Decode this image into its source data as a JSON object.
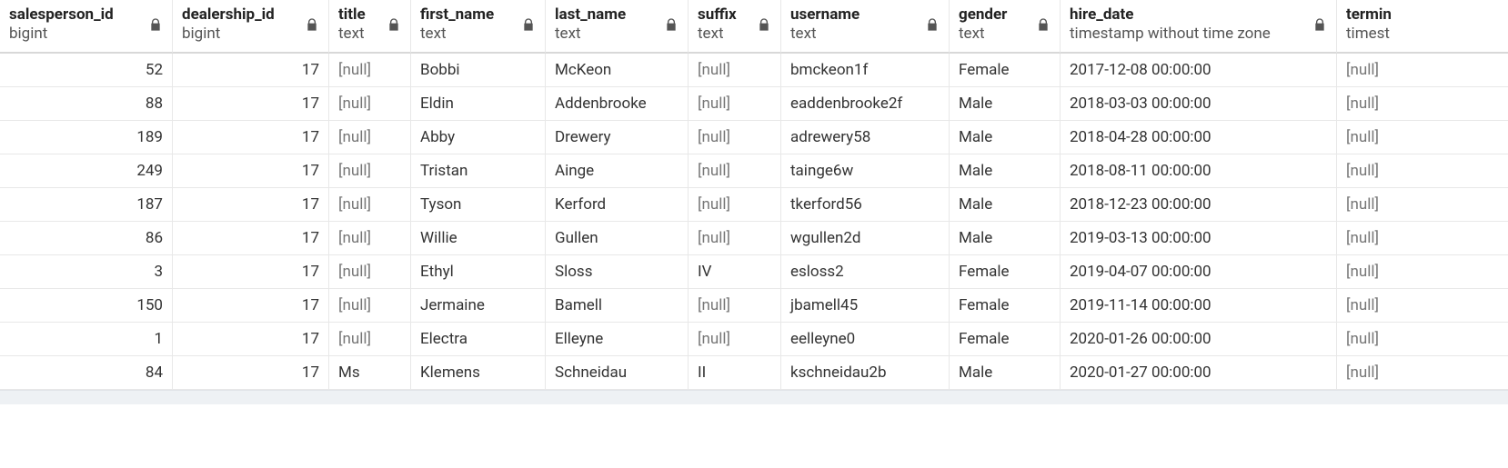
{
  "null_label": "[null]",
  "columns": [
    {
      "name": "salesperson_id",
      "type": "bigint",
      "align": "num",
      "locked": true
    },
    {
      "name": "dealership_id",
      "type": "bigint",
      "align": "num",
      "locked": true
    },
    {
      "name": "title",
      "type": "text",
      "align": "left",
      "locked": true
    },
    {
      "name": "first_name",
      "type": "text",
      "align": "left",
      "locked": true
    },
    {
      "name": "last_name",
      "type": "text",
      "align": "left",
      "locked": true
    },
    {
      "name": "suffix",
      "type": "text",
      "align": "left",
      "locked": true
    },
    {
      "name": "username",
      "type": "text",
      "align": "left",
      "locked": true
    },
    {
      "name": "gender",
      "type": "text",
      "align": "left",
      "locked": true
    },
    {
      "name": "hire_date",
      "type": "timestamp without time zone",
      "align": "left",
      "locked": true
    },
    {
      "name": "termin",
      "type": "timest",
      "align": "left",
      "locked": false
    }
  ],
  "rows": [
    {
      "salesperson_id": 52,
      "dealership_id": 17,
      "title": null,
      "first_name": "Bobbi",
      "last_name": "McKeon",
      "suffix": null,
      "username": "bmckeon1f",
      "gender": "Female",
      "hire_date": "2017-12-08 00:00:00",
      "termin": null
    },
    {
      "salesperson_id": 88,
      "dealership_id": 17,
      "title": null,
      "first_name": "Eldin",
      "last_name": "Addenbrooke",
      "suffix": null,
      "username": "eaddenbrooke2f",
      "gender": "Male",
      "hire_date": "2018-03-03 00:00:00",
      "termin": null
    },
    {
      "salesperson_id": 189,
      "dealership_id": 17,
      "title": null,
      "first_name": "Abby",
      "last_name": "Drewery",
      "suffix": null,
      "username": "adrewery58",
      "gender": "Male",
      "hire_date": "2018-04-28 00:00:00",
      "termin": null
    },
    {
      "salesperson_id": 249,
      "dealership_id": 17,
      "title": null,
      "first_name": "Tristan",
      "last_name": "Ainge",
      "suffix": null,
      "username": "tainge6w",
      "gender": "Male",
      "hire_date": "2018-08-11 00:00:00",
      "termin": null
    },
    {
      "salesperson_id": 187,
      "dealership_id": 17,
      "title": null,
      "first_name": "Tyson",
      "last_name": "Kerford",
      "suffix": null,
      "username": "tkerford56",
      "gender": "Male",
      "hire_date": "2018-12-23 00:00:00",
      "termin": null
    },
    {
      "salesperson_id": 86,
      "dealership_id": 17,
      "title": null,
      "first_name": "Willie",
      "last_name": "Gullen",
      "suffix": null,
      "username": "wgullen2d",
      "gender": "Male",
      "hire_date": "2019-03-13 00:00:00",
      "termin": null
    },
    {
      "salesperson_id": 3,
      "dealership_id": 17,
      "title": null,
      "first_name": "Ethyl",
      "last_name": "Sloss",
      "suffix": "IV",
      "username": "esloss2",
      "gender": "Female",
      "hire_date": "2019-04-07 00:00:00",
      "termin": null
    },
    {
      "salesperson_id": 150,
      "dealership_id": 17,
      "title": null,
      "first_name": "Jermaine",
      "last_name": "Bamell",
      "suffix": null,
      "username": "jbamell45",
      "gender": "Female",
      "hire_date": "2019-11-14 00:00:00",
      "termin": null
    },
    {
      "salesperson_id": 1,
      "dealership_id": 17,
      "title": null,
      "first_name": "Electra",
      "last_name": "Elleyne",
      "suffix": null,
      "username": "eelleyne0",
      "gender": "Female",
      "hire_date": "2020-01-26 00:00:00",
      "termin": null
    },
    {
      "salesperson_id": 84,
      "dealership_id": 17,
      "title": "Ms",
      "first_name": "Klemens",
      "last_name": "Schneidau",
      "suffix": "II",
      "username": "kschneidau2b",
      "gender": "Male",
      "hire_date": "2020-01-27 00:00:00",
      "termin": null
    }
  ]
}
